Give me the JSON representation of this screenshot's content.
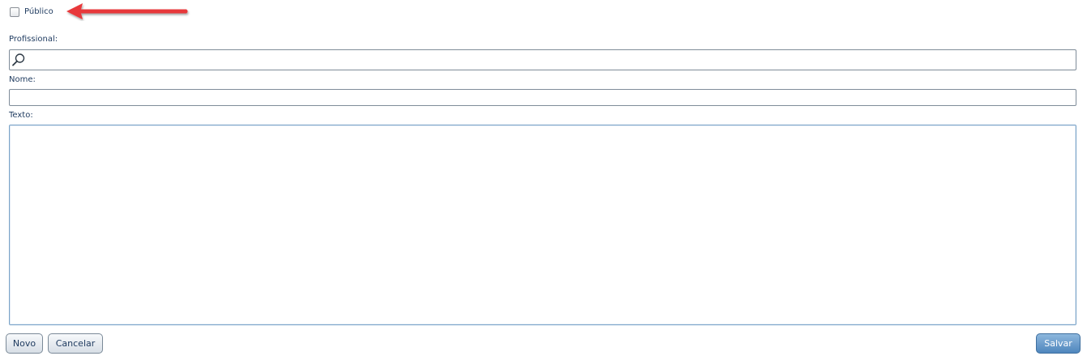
{
  "form": {
    "public_checkbox": {
      "label": "Público",
      "checked": false
    },
    "professional": {
      "label": "Profissional:",
      "value": "",
      "icon": "search-icon"
    },
    "name": {
      "label": "Nome:",
      "value": ""
    },
    "text": {
      "label": "Texto:",
      "value": ""
    }
  },
  "buttons": {
    "new_label": "Novo",
    "cancel_label": "Cancelar",
    "save_label": "Salvar"
  },
  "colors": {
    "label_text": "#1e3a5f",
    "annotation_arrow": "#e8383b",
    "primary_button": "#4f86bd"
  }
}
